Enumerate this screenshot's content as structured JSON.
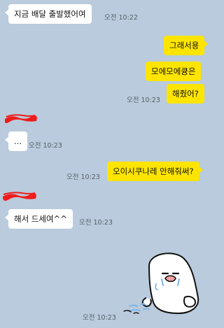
{
  "colors": {
    "background": "#b9cbdc",
    "incoming_bubble": "#ffffff",
    "outgoing_bubble": "#fee500",
    "timestamp": "#555f68",
    "redaction": "#ef1c1c"
  },
  "messages": [
    {
      "direction": "incoming",
      "text": "지금 배달 출발했어여",
      "time": "오전 10:22"
    },
    {
      "direction": "outgoing",
      "text": "그래서용"
    },
    {
      "direction": "outgoing",
      "text": "모에모에큥은"
    },
    {
      "direction": "outgoing",
      "text": "해줬어?",
      "time": "오전 10:23"
    },
    {
      "direction": "incoming",
      "text": "...",
      "time": "오전 10:23"
    },
    {
      "direction": "outgoing",
      "text": "오이시쿠나레 안해줘써?",
      "time": "오전 10:23"
    },
    {
      "direction": "incoming",
      "text": "해서 드세여^^",
      "time": "오전 10:23"
    },
    {
      "direction": "incoming",
      "sticker": "crying-white-ghost-blob",
      "time": "오전 10:23"
    }
  ]
}
